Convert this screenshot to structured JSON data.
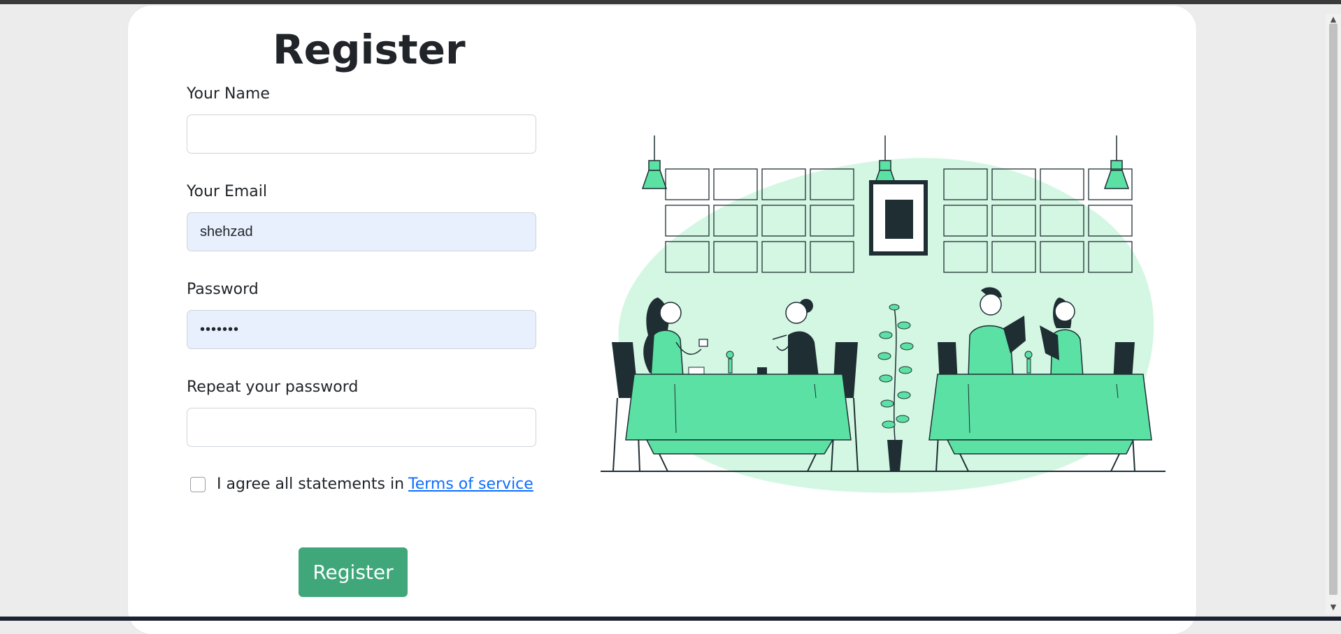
{
  "page": {
    "title": "Register"
  },
  "form": {
    "name_label": "Your Name",
    "name_value": "",
    "email_label": "Your Email",
    "email_value": "shehzad",
    "password_label": "Password",
    "password_value": "1234567",
    "repeat_label": "Repeat your password",
    "repeat_value": "",
    "agree_text": "I agree all statements in",
    "terms_link": "Terms of service",
    "agree_checked": false,
    "submit_label": "Register"
  },
  "colors": {
    "accent": "#3fa77a",
    "illustration_green": "#5ce1a4",
    "illustration_light": "#d4f7e3",
    "illustration_dark": "#1e2e33",
    "link": "#0d6efd",
    "autofill_bg": "#e8f0fe"
  },
  "illustration": {
    "icon": "restaurant-dining-illustration"
  }
}
